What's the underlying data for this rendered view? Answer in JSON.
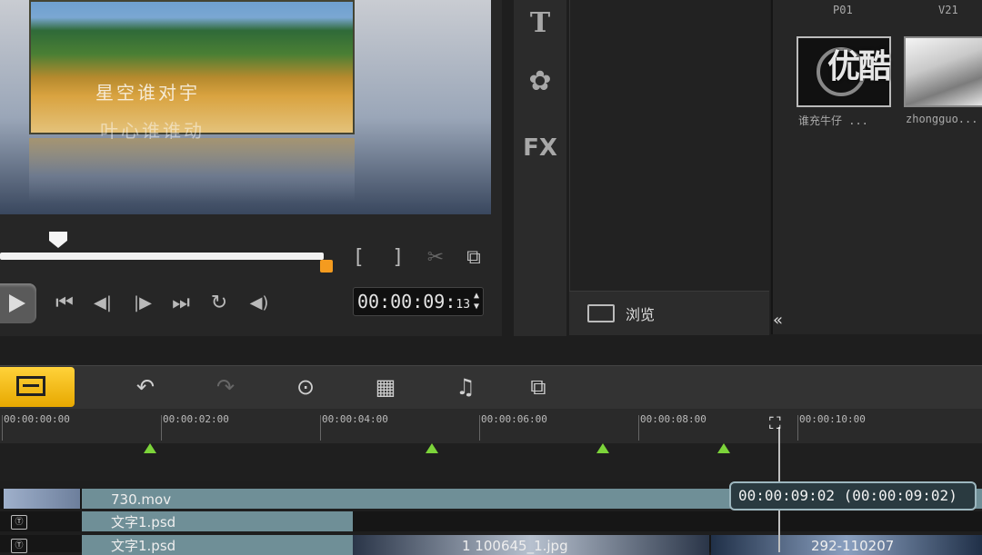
{
  "preview": {
    "overlay_line1": "星空谁对宇",
    "overlay_line2": "叶心谁谁动",
    "timecode_main": "00:00:09:",
    "timecode_frames": "13",
    "mark_in": "[",
    "mark_out": "]"
  },
  "playback_controls": {
    "home": "⏮",
    "prev_frame": "◀|",
    "next_frame": "|▶",
    "end": "⏭",
    "repeat": "↻",
    "volume": "◀)"
  },
  "tool_strip": {
    "title_tool": "T",
    "transition_tool": "✿",
    "fx_tool": "FX"
  },
  "browse": {
    "label": "浏览"
  },
  "library": {
    "columns": [
      "P01",
      "V21"
    ],
    "items": [
      {
        "label": "谁充牛仔 ..."
      },
      {
        "label": "zhongguo..."
      }
    ],
    "collapse": "«",
    "watermark": "优酷"
  },
  "toolbar": {
    "undo": "↶",
    "redo": "↷",
    "record": "⊙",
    "auto_music": "▦",
    "sound_mixer": "♫",
    "motion": "⧉"
  },
  "ruler": {
    "ticks": [
      "00:00:00:00",
      "00:00:02:00",
      "00:00:04:00",
      "00:00:06:00",
      "00:00:08:00",
      "00:00:10:00"
    ]
  },
  "tracks": [
    {
      "badge": "",
      "clip": "730.mov"
    },
    {
      "badge": "Ⓣ",
      "clip": "文字1.psd"
    },
    {
      "badge": "Ⓣ",
      "clip": "文字1.psd",
      "extra_clip": "1 100645_1.jpg",
      "extra_clip2": "292-110207"
    }
  ],
  "tooltip": {
    "text": "00:00:09:02 (00:00:09:02)"
  },
  "colors": {
    "accent_orange": "#f49b1f",
    "storyboard_yellow": "#ffc81e",
    "marker_green": "#7cd43a",
    "track_teal": "#6f8f97"
  }
}
